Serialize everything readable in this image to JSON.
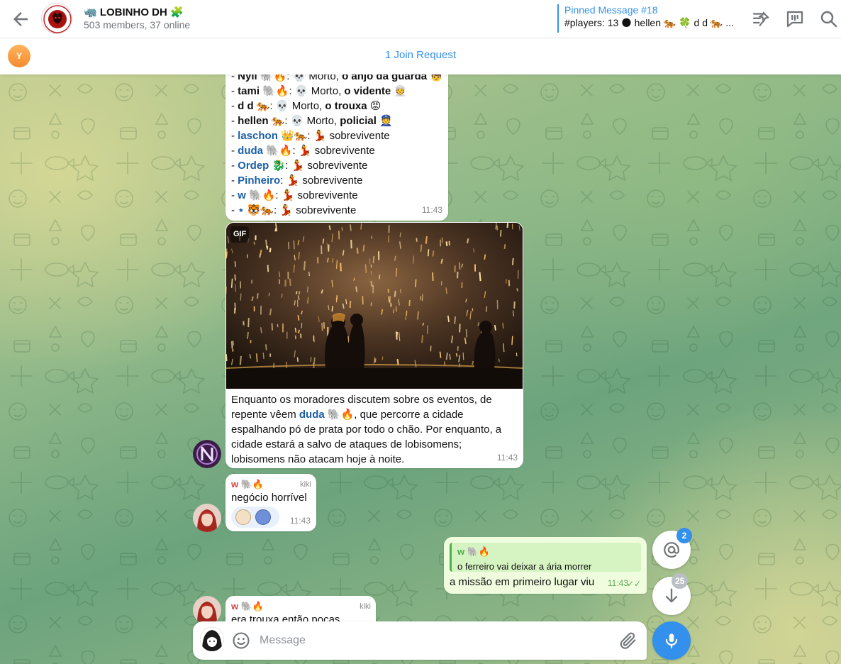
{
  "header": {
    "title": "🦏 LOBINHO DH 🧩",
    "subtitle": "503 members, 37 online",
    "pinned": {
      "title": "Pinned Message #18",
      "text": "#players: 13 🌑 hellen 🐅 🍀 d d 🐅 ..."
    },
    "icons": [
      "back-arrow-icon",
      "unpin-list-icon",
      "topics-icon",
      "search-icon"
    ]
  },
  "join_bar": {
    "avatar_initial": "Y",
    "label": "1 Join Request"
  },
  "messages": {
    "list": {
      "lines": [
        {
          "prefix": "- ",
          "name": "Nyli",
          "icons": " 🐘🔥",
          "rest": ": 💀 Morto, ",
          "role": "o anjo da guarda",
          "emoji": " 👼"
        },
        {
          "prefix": "- ",
          "name": "tami",
          "icons": " 🐘🔥",
          "rest": ": 💀 Morto, ",
          "role": "o vidente",
          "emoji": " 👳"
        },
        {
          "prefix": "- ",
          "name": "d d",
          "icons": " 🐅",
          "rest": ": 💀 Morto, ",
          "role": "o trouxa",
          "emoji": " 😡"
        },
        {
          "prefix": "- ",
          "name": "hellen",
          "icons": " 🐅",
          "rest": ": 💀 Morto, ",
          "role": "policial",
          "emoji": " 👮"
        },
        {
          "prefix": "- ",
          "name": "laschon",
          "icons": " 👑🐅",
          "rest": ": 💃 sobrevivente",
          "role": "",
          "emoji": ""
        },
        {
          "prefix": "- ",
          "name": "duda",
          "icons": " 🐘🔥",
          "rest": ": 💃 sobrevivente",
          "role": "",
          "emoji": ""
        },
        {
          "prefix": "- ",
          "name": "Ordep",
          "icons": " 🐉",
          "rest": ": 💃 sobrevivente",
          "role": "",
          "emoji": ""
        },
        {
          "prefix": "- ",
          "name": "Pinheiro",
          "icons": "",
          "rest": ": 💃 sobrevivente",
          "role": "",
          "emoji": ""
        },
        {
          "prefix": "- ",
          "name": "w",
          "icons": " 🐘🔥",
          "rest": ": 💃 sobrevivente",
          "role": "",
          "emoji": ""
        },
        {
          "prefix": "- ",
          "name": "⋆",
          "icons": " 🐯🐅",
          "rest": ": 💃 sobrevivente",
          "role": "",
          "emoji": ""
        }
      ],
      "time": "11:43"
    },
    "gif_post": {
      "label": "GIF",
      "caption_before": "Enquanto os moradores discutem sobre os eventos, de repente vêem ",
      "caption_name": "duda",
      "caption_after": " 🐘🔥, que percorre a cidade espalhando pó de prata por todo o chão. Por enquanto, a cidade estará a salvo de ataques de lobisomens; lobisomens não atacam hoje à noite.",
      "time": "11:43"
    },
    "msg_kiki_1": {
      "sender": "w 🐘🔥",
      "via": "kiki",
      "text": "negócio horrível",
      "time": "11:43"
    },
    "msg_own": {
      "reply_name": "w 🐘🔥",
      "reply_text": "o ferreiro vai deixar a ária morrer",
      "text": "a missão em primeiro lugar viu",
      "time": "11:43",
      "ticks": "✓✓"
    },
    "msg_kiki_2": {
      "sender": "w 🐘🔥",
      "via": "kiki",
      "text": "era trouxa então pocas"
    }
  },
  "floating": {
    "mentions_badge": "2",
    "scroll_badge": "25"
  },
  "composer": {
    "placeholder": "Message"
  },
  "colors": {
    "accent": "#3390ec",
    "own_bubble": "#effdde",
    "sender_red": "#d8423c",
    "link_blue": "#1a5fa6"
  }
}
